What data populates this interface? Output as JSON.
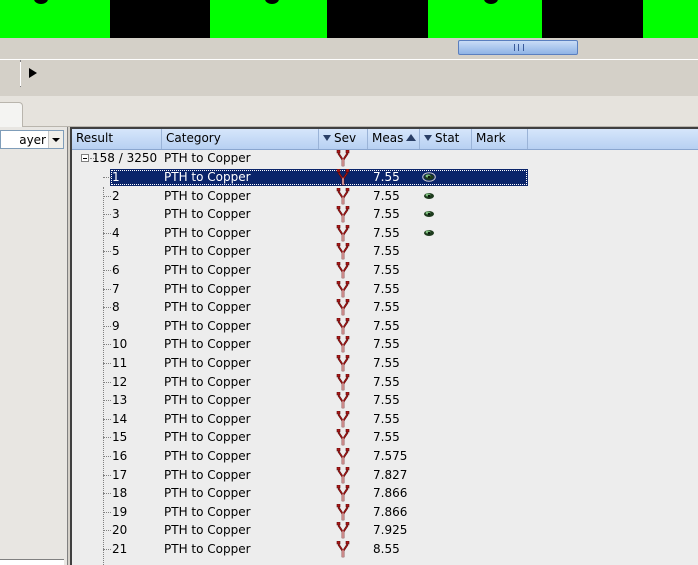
{
  "grid": {
    "columns": [
      {
        "key": "result",
        "label": "Result",
        "filter": false,
        "sort": ""
      },
      {
        "key": "category",
        "label": "Category",
        "filter": false,
        "sort": ""
      },
      {
        "key": "sev",
        "label": "Sev",
        "filter": true,
        "sort": ""
      },
      {
        "key": "meas",
        "label": "Meas",
        "filter": false,
        "sort": "asc"
      },
      {
        "key": "stat",
        "label": "Stat",
        "filter": true,
        "sort": ""
      },
      {
        "key": "mark",
        "label": "Mark",
        "filter": false,
        "sort": ""
      }
    ],
    "root": {
      "result": "158 / 3250",
      "category": "PTH to Copper"
    },
    "rows": [
      {
        "result": "1",
        "category": "PTH to Copper",
        "meas": "7.55",
        "stat": "viewed-selected",
        "selected": true
      },
      {
        "result": "2",
        "category": "PTH to Copper",
        "meas": "7.55",
        "stat": "viewed"
      },
      {
        "result": "3",
        "category": "PTH to Copper",
        "meas": "7.55",
        "stat": "viewed"
      },
      {
        "result": "4",
        "category": "PTH to Copper",
        "meas": "7.55",
        "stat": "viewed"
      },
      {
        "result": "5",
        "category": "PTH to Copper",
        "meas": "7.55",
        "stat": ""
      },
      {
        "result": "6",
        "category": "PTH to Copper",
        "meas": "7.55",
        "stat": ""
      },
      {
        "result": "7",
        "category": "PTH to Copper",
        "meas": "7.55",
        "stat": ""
      },
      {
        "result": "8",
        "category": "PTH to Copper",
        "meas": "7.55",
        "stat": ""
      },
      {
        "result": "9",
        "category": "PTH to Copper",
        "meas": "7.55",
        "stat": ""
      },
      {
        "result": "10",
        "category": "PTH to Copper",
        "meas": "7.55",
        "stat": ""
      },
      {
        "result": "11",
        "category": "PTH to Copper",
        "meas": "7.55",
        "stat": ""
      },
      {
        "result": "12",
        "category": "PTH to Copper",
        "meas": "7.55",
        "stat": ""
      },
      {
        "result": "13",
        "category": "PTH to Copper",
        "meas": "7.55",
        "stat": ""
      },
      {
        "result": "14",
        "category": "PTH to Copper",
        "meas": "7.55",
        "stat": ""
      },
      {
        "result": "15",
        "category": "PTH to Copper",
        "meas": "7.55",
        "stat": ""
      },
      {
        "result": "16",
        "category": "PTH to Copper",
        "meas": "7.575",
        "stat": ""
      },
      {
        "result": "17",
        "category": "PTH to Copper",
        "meas": "7.827",
        "stat": ""
      },
      {
        "result": "18",
        "category": "PTH to Copper",
        "meas": "7.866",
        "stat": ""
      },
      {
        "result": "19",
        "category": "PTH to Copper",
        "meas": "7.866",
        "stat": ""
      },
      {
        "result": "20",
        "category": "PTH to Copper",
        "meas": "7.925",
        "stat": ""
      },
      {
        "result": "21",
        "category": "PTH to Copper",
        "meas": "8.55",
        "stat": ""
      }
    ]
  },
  "left_panel": {
    "layer_select_value": "ayer"
  },
  "icons": {
    "sev": "error-severity-icon",
    "stat_viewed": "eye-icon",
    "play": "play-icon"
  },
  "colors": {
    "selection": "#0a246a",
    "header": "#c6dbf5",
    "severity": "#b01818",
    "pattern_green": "#00ff00"
  }
}
